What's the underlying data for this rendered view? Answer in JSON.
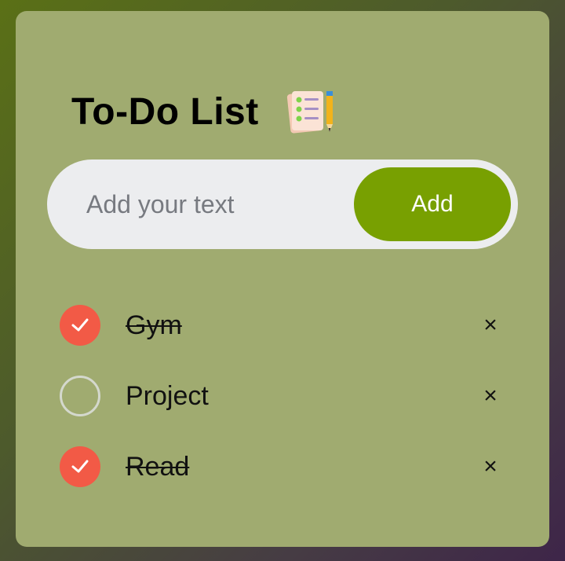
{
  "header": {
    "title": "To-Do List",
    "icon": "checklist-notepad-pencil-icon"
  },
  "composer": {
    "placeholder": "Add your text",
    "value": "",
    "add_label": "Add"
  },
  "tasks": [
    {
      "label": "Gym",
      "done": true,
      "delete_symbol": "×"
    },
    {
      "label": "Project",
      "done": false,
      "delete_symbol": "×"
    },
    {
      "label": "Read",
      "done": true,
      "delete_symbol": "×"
    }
  ],
  "colors": {
    "card_background": "#a0ab70",
    "accent_green": "#78a001",
    "checked_red": "#f25a46",
    "input_background": "#ecedef"
  }
}
